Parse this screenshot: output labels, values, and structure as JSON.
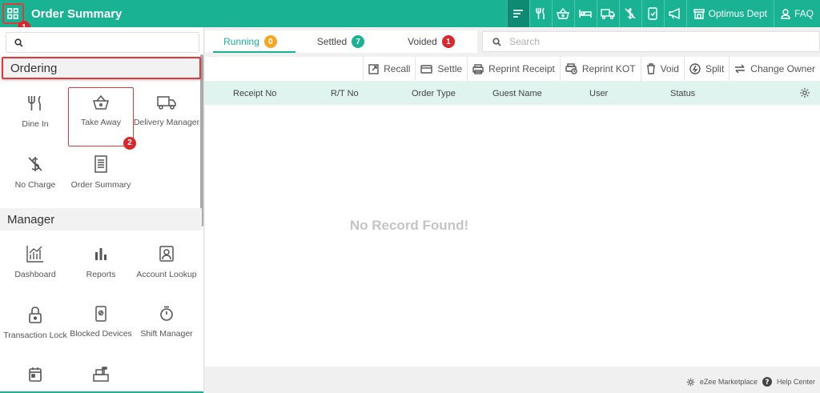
{
  "header": {
    "title": "Order Summary",
    "department": "Optimus Dept",
    "faq": "FAQ",
    "accent": "#19b394"
  },
  "annotations": {
    "marker1": "1",
    "marker2": "2"
  },
  "sidebar": {
    "search_placeholder": "",
    "ordering": {
      "heading": "Ordering",
      "items": [
        "Dine In",
        "Take Away",
        "Delivery Manager",
        "No Charge",
        "Order Summary"
      ]
    },
    "manager": {
      "heading": "Manager",
      "items": [
        "Dashboard",
        "Reports",
        "Account Lookup",
        "Transaction Lock",
        "Blocked Devices",
        "Shift Manager"
      ]
    }
  },
  "tabs": [
    {
      "label": "Running",
      "count": "0",
      "color": "#f5a623"
    },
    {
      "label": "Settled",
      "count": "7",
      "color": "#19b394"
    },
    {
      "label": "Voided",
      "count": "1",
      "color": "#d9272e"
    }
  ],
  "search": {
    "placeholder": "Search"
  },
  "toolbar": [
    "Recall",
    "Settle",
    "Reprint Receipt",
    "Reprint KOT",
    "Void",
    "Split",
    "Change Owner"
  ],
  "table": {
    "columns": [
      "Receipt No",
      "R/T No",
      "Order Type",
      "Guest Name",
      "User",
      "Status"
    ],
    "empty_message": "No Record Found!"
  },
  "footer": {
    "marketplace": "eZee Marketplace",
    "help": "Help Center"
  }
}
